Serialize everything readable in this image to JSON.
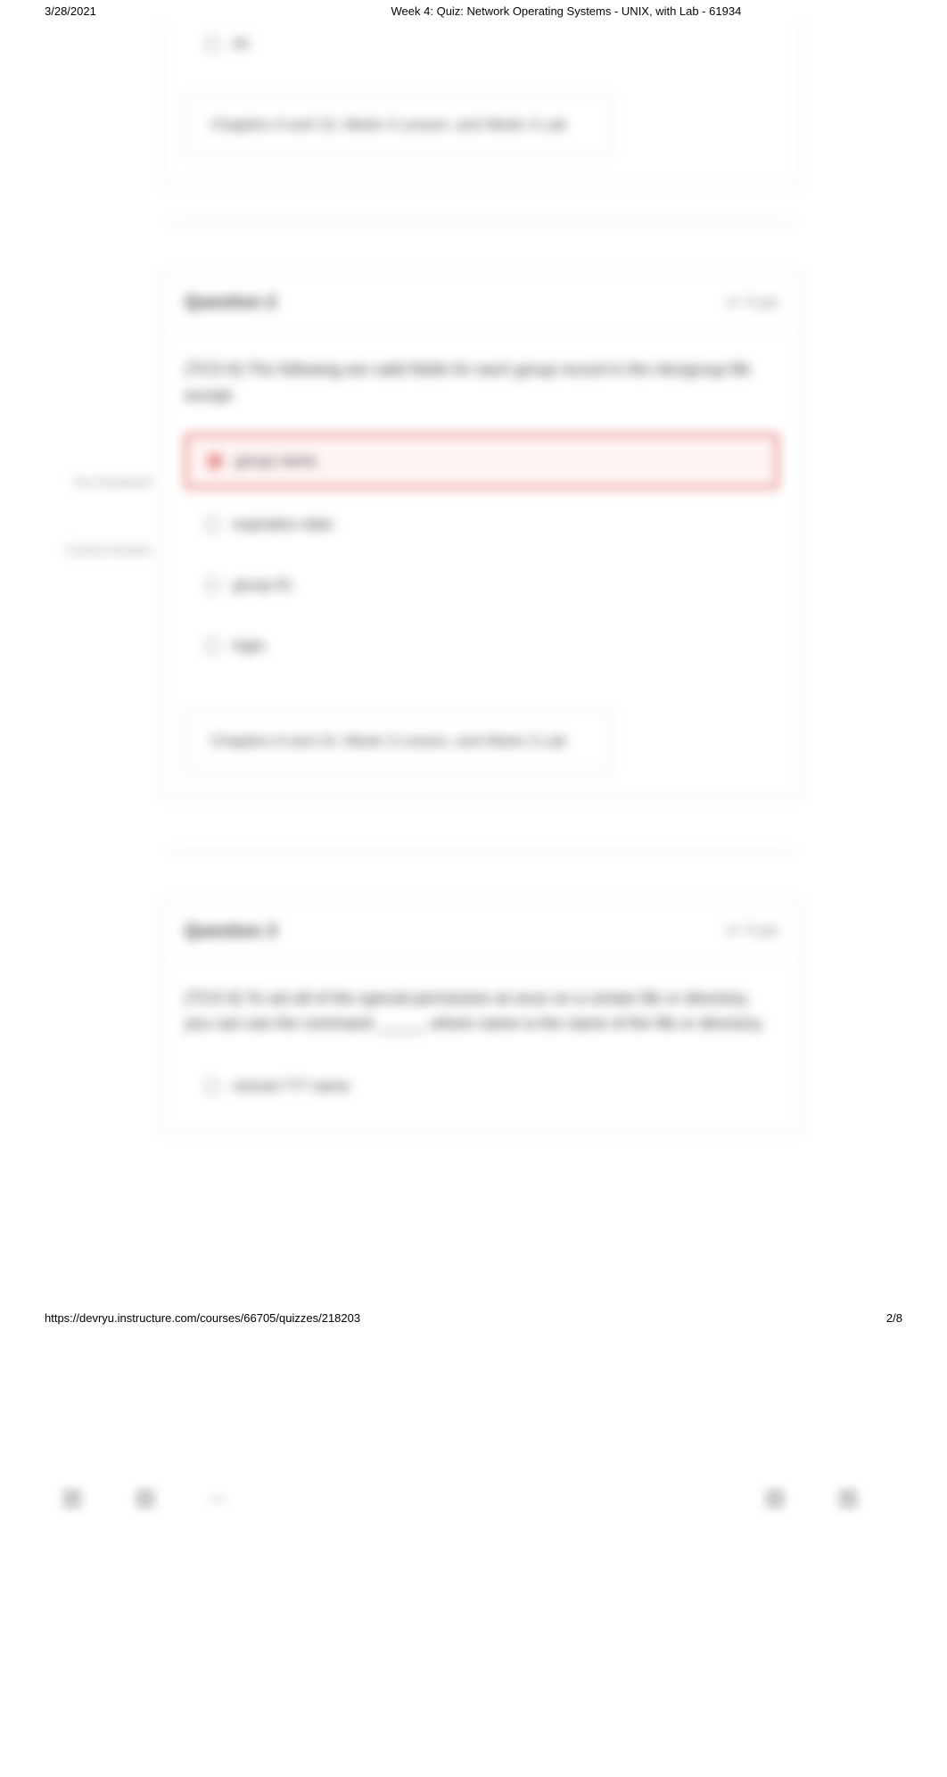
{
  "print": {
    "date": "3/28/2021",
    "title": "Week 4: Quiz: Network Operating Systems - UNIX, with Lab - 61934",
    "url": "https://devryu.instructure.com/courses/66705/quizzes/218203",
    "page": "2/8"
  },
  "sidebar": {
    "line1": "You Answered",
    "line2": "Correct Answer"
  },
  "partialTop": {
    "lastOption": "sh",
    "chapterRef": "Chapters 9 and 10, Week 3 Lesson, and Week 3 Lab"
  },
  "q2": {
    "title": "Question 2",
    "pts": "0 / 5 pts",
    "text": "(TCO 6) The following are valid fields for each group record in the /etc/group file except",
    "optA": "group name.",
    "optB": "expiration date.",
    "optC": "group ID.",
    "optD": "login.",
    "chapterRef": "Chapters 9 and 10, Week 3 Lesson, and Week 3 Lab"
  },
  "q3": {
    "title": "Question 3",
    "pts": "0 / 5 pts",
    "text": "(TCO 6) To set all of the special permission at once on a certain file or directory, you can use the command _____, where name is the name of the file or directory.",
    "optA": "chmod 777 name"
  }
}
